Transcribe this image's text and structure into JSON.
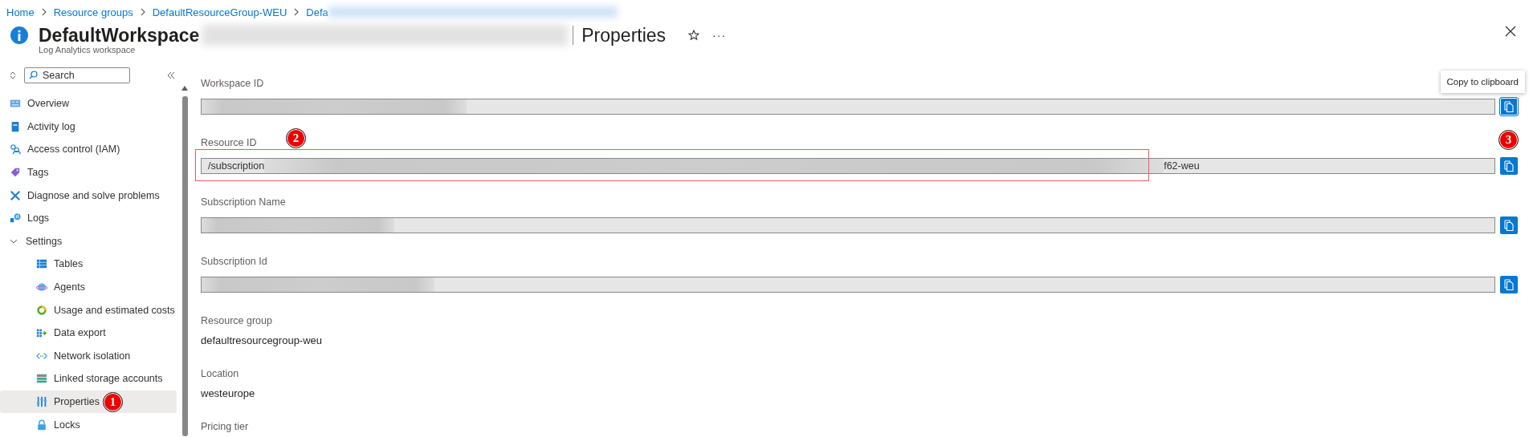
{
  "breadcrumb": [
    "Home",
    "Resource groups",
    "DefaultResourceGroup-WEU",
    "Defa"
  ],
  "header": {
    "title": "DefaultWorkspace",
    "page": "Properties",
    "subtitle": "Log Analytics workspace",
    "more": "···"
  },
  "sidebar": {
    "search": {
      "placeholder": "Search"
    },
    "items": [
      {
        "label": "Overview",
        "selected": false
      },
      {
        "label": "Activity log",
        "selected": false
      },
      {
        "label": "Access control (IAM)",
        "selected": false
      },
      {
        "label": "Tags",
        "selected": false
      },
      {
        "label": "Diagnose and solve problems",
        "selected": false
      },
      {
        "label": "Logs",
        "selected": false
      },
      {
        "label": "Settings",
        "selected": false,
        "expanded": true,
        "children": [
          {
            "label": "Tables",
            "selected": false
          },
          {
            "label": "Agents",
            "selected": false
          },
          {
            "label": "Usage and estimated costs",
            "selected": false
          },
          {
            "label": "Data export",
            "selected": false
          },
          {
            "label": "Network isolation",
            "selected": false
          },
          {
            "label": "Linked storage accounts",
            "selected": false
          },
          {
            "label": "Properties",
            "selected": true,
            "badge": "1"
          },
          {
            "label": "Locks",
            "selected": false
          }
        ]
      }
    ]
  },
  "fields": [
    {
      "kind": "copy",
      "label": "Workspace ID",
      "copy_focused": true,
      "tooltip": "Copy to clipboard"
    },
    {
      "kind": "copy",
      "label": "Resource ID",
      "value_start": "/subscription",
      "value_end": "f62-weu",
      "highlighted": true,
      "badge": "2",
      "copy_badge": "3",
      "copy_focused": false
    },
    {
      "kind": "copy",
      "label": "Subscription Name",
      "copy_focused": false
    },
    {
      "kind": "copy",
      "label": "Subscription Id",
      "copy_focused": false
    },
    {
      "kind": "text",
      "label": "Resource group",
      "value": "defaultresourcegroup-weu"
    },
    {
      "kind": "text",
      "label": "Location",
      "value": "westeurope"
    },
    {
      "kind": "text",
      "label": "Pricing tier"
    }
  ]
}
